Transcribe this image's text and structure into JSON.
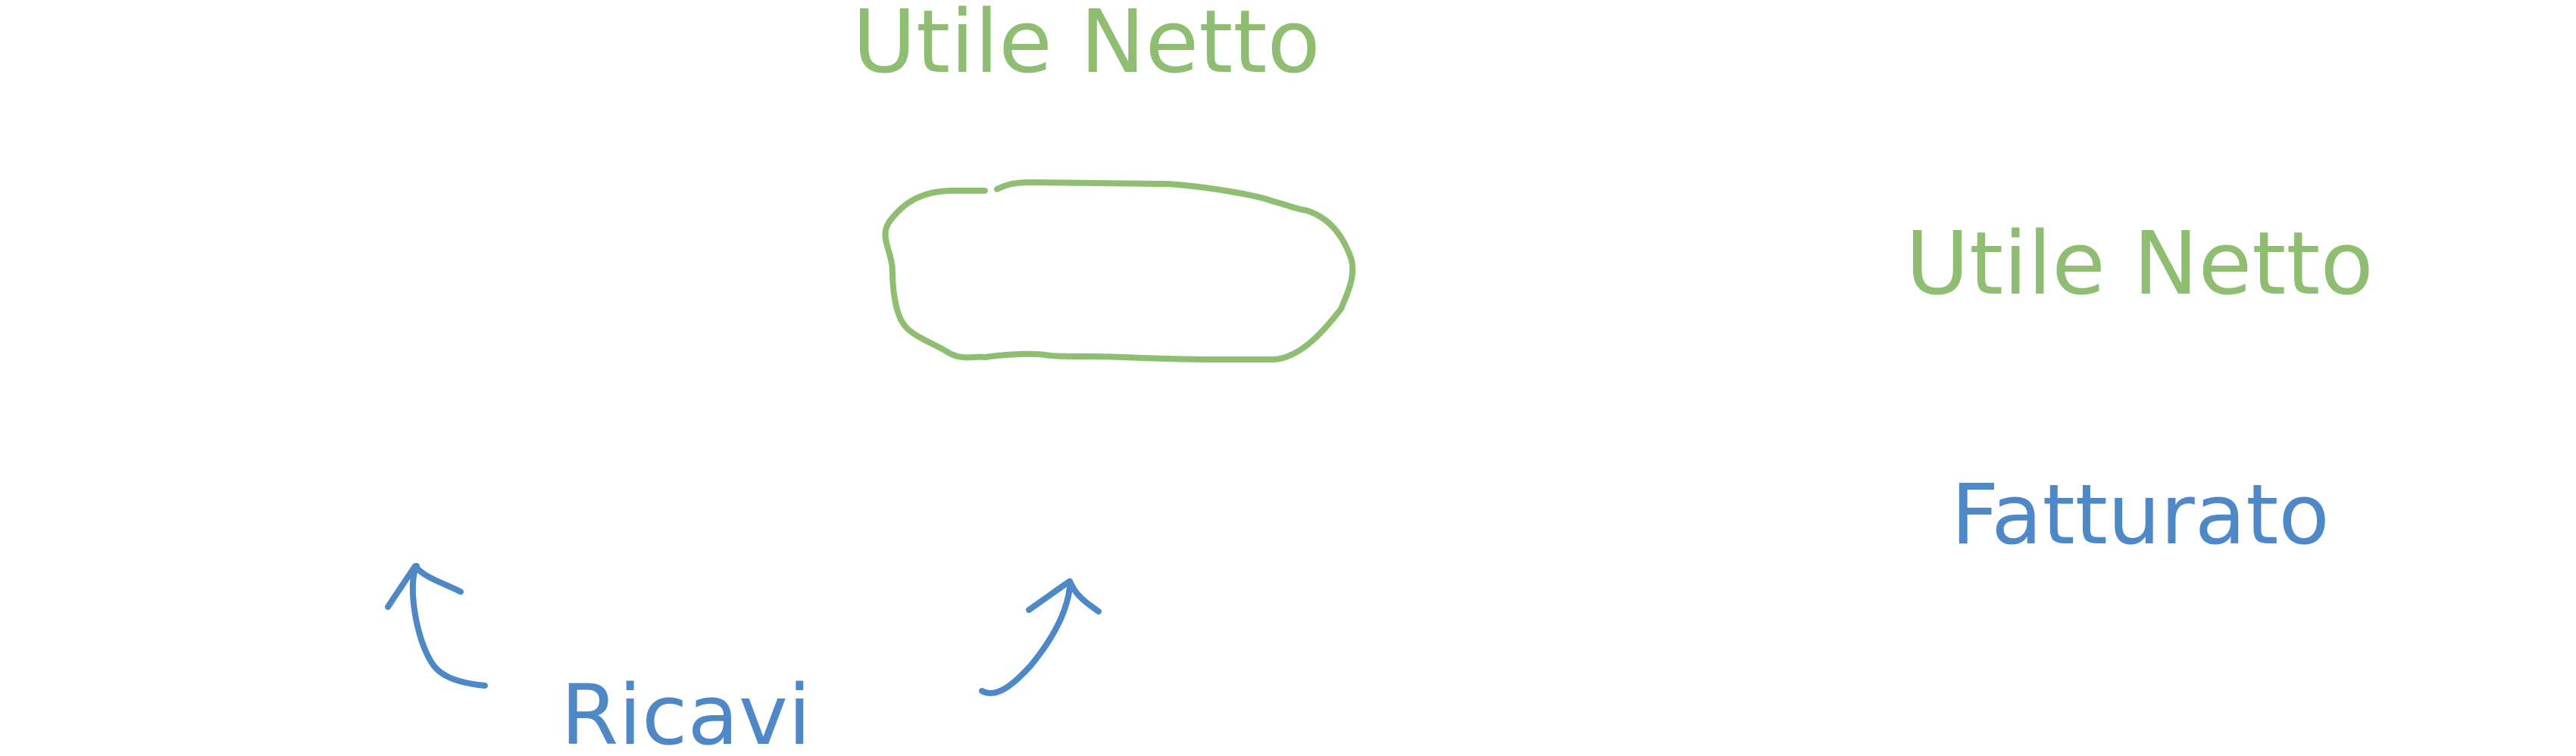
{
  "diagram": {
    "top_label": "Utile Netto",
    "box_placeholder": "",
    "legend_green_label": "Utile Netto",
    "legend_blue_label": "Fatturato",
    "bottom_label": "Ricavi",
    "colors": {
      "green": "#8FBE72",
      "blue": "#4F88C6",
      "background": "#FFFFFF"
    }
  }
}
